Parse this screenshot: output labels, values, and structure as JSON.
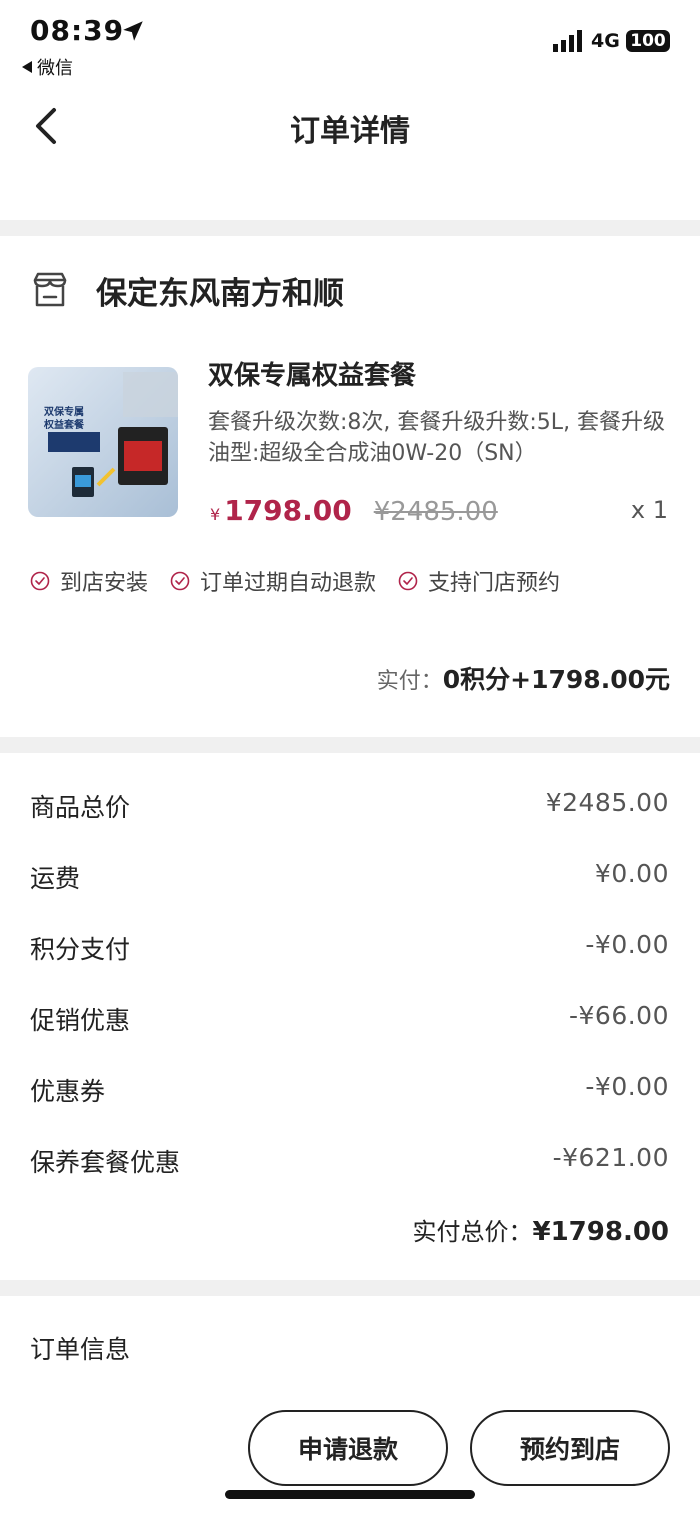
{
  "status_bar": {
    "time": "08:39",
    "back_app": "微信",
    "network": "4G",
    "battery": "100",
    "icons": [
      "location-arrow-icon",
      "signal-icon"
    ]
  },
  "nav": {
    "title": "订单详情",
    "back_icon": "chevron-left-icon"
  },
  "store": {
    "icon": "store-icon",
    "name": "保定东风南方和顺"
  },
  "product": {
    "title": "双保专属权益套餐",
    "spec": "套餐升级次数:8次, 套餐升级升数:5L, 套餐升级油型:超级全合成油0W-20（SN）",
    "currency_symbol": "¥",
    "price": "1798.00",
    "original_price": "¥2485.00",
    "quantity": "x 1",
    "image_text": [
      "双保专属",
      "权益套餐"
    ]
  },
  "tags": [
    {
      "label": "到店安装"
    },
    {
      "label": "订单过期自动退款"
    },
    {
      "label": "支持门店预约"
    }
  ],
  "paid": {
    "label": "实付：",
    "value": "0积分+1798.00元"
  },
  "summary": {
    "rows": [
      {
        "label": "商品总价",
        "value": "¥2485.00"
      },
      {
        "label": "运费",
        "value": "¥0.00"
      },
      {
        "label": "积分支付",
        "value": "-¥0.00"
      },
      {
        "label": "促销优惠",
        "value": "-¥66.00"
      },
      {
        "label": "优惠券",
        "value": "-¥0.00"
      },
      {
        "label": "保养套餐优惠",
        "value": "-¥621.00"
      }
    ],
    "total_label": "实付总价：",
    "total_value": "¥1798.00"
  },
  "order_info": {
    "title": "订单信息"
  },
  "actions": {
    "refund_label": "申请退款",
    "book_label": "预约到店"
  },
  "colors": {
    "accent": "#b0244a",
    "band": "#f0f0f0"
  }
}
